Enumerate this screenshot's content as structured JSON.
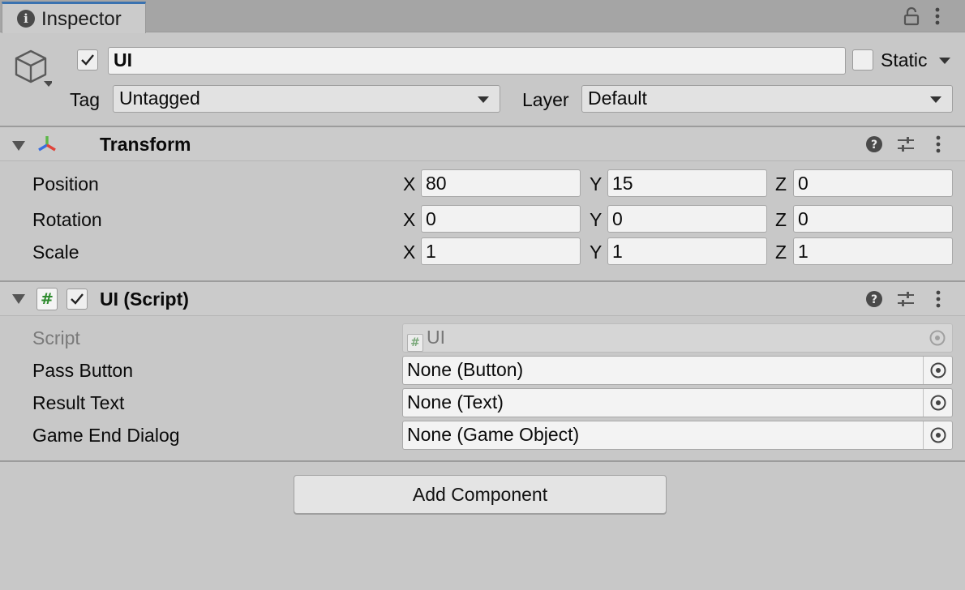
{
  "tab": {
    "label": "Inspector"
  },
  "object": {
    "name": "UI",
    "active": true,
    "static_label": "Static",
    "static": false
  },
  "tag": {
    "label": "Tag",
    "value": "Untagged"
  },
  "layer": {
    "label": "Layer",
    "value": "Default"
  },
  "transform": {
    "title": "Transform",
    "axes": [
      "X",
      "Y",
      "Z"
    ],
    "rows": [
      {
        "label": "Position",
        "x": "80",
        "y": "15",
        "z": "0"
      },
      {
        "label": "Rotation",
        "x": "0",
        "y": "0",
        "z": "0"
      },
      {
        "label": "Scale",
        "x": "1",
        "y": "1",
        "z": "1"
      }
    ]
  },
  "script_component": {
    "title": "UI (Script)",
    "enabled": true,
    "script_label": "Script",
    "script_value": "UI",
    "fields": [
      {
        "label": "Pass Button",
        "value": "None (Button)"
      },
      {
        "label": "Result Text",
        "value": "None (Text)"
      },
      {
        "label": "Game End Dialog",
        "value": "None (Game Object)"
      }
    ]
  },
  "add_component": {
    "label": "Add Component"
  },
  "colors": {
    "tab_accent": "#3a72b0",
    "axis_x": "#e0443a",
    "axis_y": "#5cb848",
    "axis_z": "#3a6fe0",
    "script_icon": "#2e8b2e"
  }
}
